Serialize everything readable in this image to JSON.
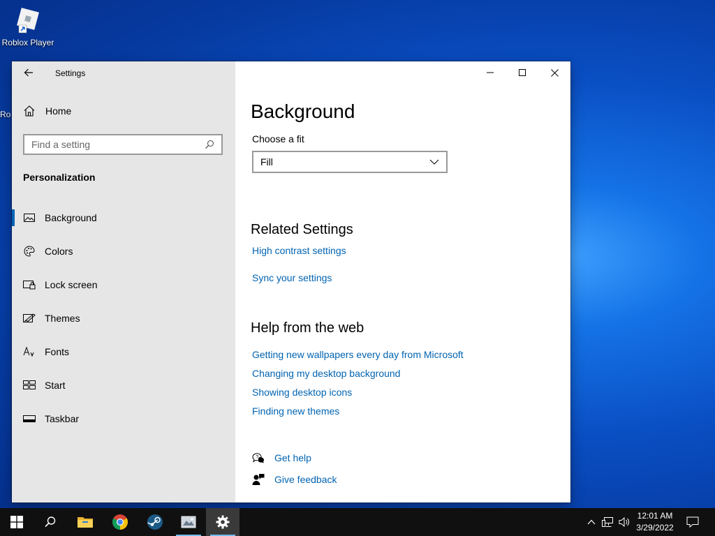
{
  "desktop": {
    "icons": [
      {
        "label": "Roblox Player"
      }
    ],
    "edge_text": "Ro"
  },
  "window": {
    "title": "Settings",
    "sidebar": {
      "home_label": "Home",
      "search_placeholder": "Find a setting",
      "section_label": "Personalization",
      "items": [
        {
          "label": "Background",
          "icon": "picture-icon",
          "active": true
        },
        {
          "label": "Colors",
          "icon": "palette-icon"
        },
        {
          "label": "Lock screen",
          "icon": "lock-screen-icon"
        },
        {
          "label": "Themes",
          "icon": "themes-icon"
        },
        {
          "label": "Fonts",
          "icon": "fonts-icon"
        },
        {
          "label": "Start",
          "icon": "start-icon"
        },
        {
          "label": "Taskbar",
          "icon": "taskbar-icon"
        }
      ]
    },
    "content": {
      "title": "Background",
      "fit_label": "Choose a fit",
      "fit_value": "Fill",
      "related_title": "Related Settings",
      "related_links": [
        "High contrast settings",
        "Sync your settings"
      ],
      "help_title": "Help from the web",
      "help_links": [
        "Getting new wallpapers every day from Microsoft",
        "Changing my desktop background",
        "Showing desktop icons",
        "Finding new themes"
      ],
      "get_help": "Get help",
      "give_feedback": "Give feedback"
    }
  },
  "taskbar": {
    "apps": [
      "start-icon",
      "search-icon",
      "file-explorer-icon",
      "chrome-icon",
      "steam-icon",
      "app-icon",
      "settings-gear-icon"
    ],
    "active_app": "settings-gear-icon",
    "time": "12:01 AM",
    "date": "3/29/2022"
  },
  "colors": {
    "accent": "#0063b1",
    "sidebar_bg": "#e6e6e6",
    "taskbar_bg": "#101010"
  }
}
